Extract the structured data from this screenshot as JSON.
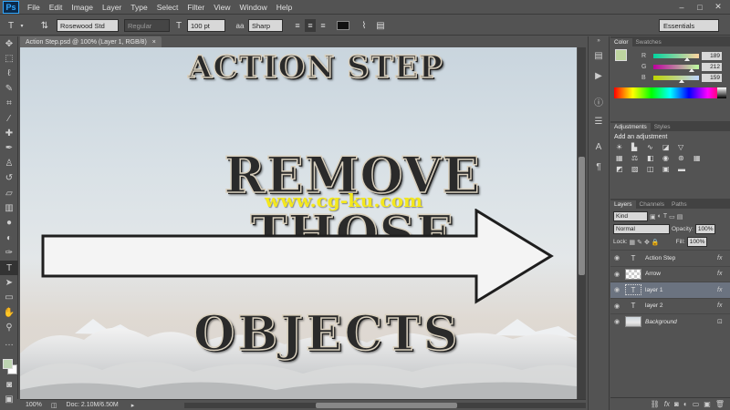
{
  "app": {
    "logo": "Ps"
  },
  "menu": [
    "File",
    "Edit",
    "Image",
    "Layer",
    "Type",
    "Select",
    "Filter",
    "View",
    "Window",
    "Help"
  ],
  "window_controls": [
    "–",
    "□",
    "✕"
  ],
  "options": {
    "font_family": "Rosewood Std",
    "font_style": "Regular",
    "font_size": "100 pt",
    "aa_label": "aa",
    "anti_alias": "Sharp",
    "workspace": "Essentials"
  },
  "document": {
    "tab_title": "Action Step.psd @ 100% (Layer 1, RGB/8)",
    "close": "×",
    "zoom": "100%",
    "doc_info": "Doc: 2.10M/6.50M"
  },
  "canvas": {
    "line1": "ACTION STEP",
    "line2": "REMOVE THOSE",
    "line3": "OBJECTS",
    "watermark": "www.cg-ku.com"
  },
  "color_panel": {
    "tabs": [
      "Color",
      "Swatches"
    ],
    "channels": [
      {
        "label": "R",
        "value": "189",
        "fraction": 0.74
      },
      {
        "label": "G",
        "value": "212",
        "fraction": 0.83
      },
      {
        "label": "B",
        "value": "159",
        "fraction": 0.62
      }
    ],
    "foreground": "#bdd49f"
  },
  "adjustments": {
    "tabs": [
      "Adjustments",
      "Styles"
    ],
    "title": "Add an adjustment"
  },
  "layers_panel": {
    "tabs": [
      "Layers",
      "Channels",
      "Paths"
    ],
    "filter": "Kind",
    "blend_mode": "Normal",
    "opacity_label": "Opacity:",
    "opacity": "100%",
    "lock_label": "Lock:",
    "fill_label": "Fill:",
    "fill": "100%",
    "layers": [
      {
        "name": "Action Step",
        "kind": "text",
        "fx": true,
        "selected": false
      },
      {
        "name": "Arrow",
        "kind": "shape",
        "fx": true,
        "selected": false
      },
      {
        "name": "layer 1",
        "kind": "text",
        "fx": true,
        "selected": true
      },
      {
        "name": "layer 2",
        "kind": "text",
        "fx": true,
        "selected": false
      },
      {
        "name": "Background",
        "kind": "image",
        "fx": false,
        "selected": false
      }
    ]
  }
}
